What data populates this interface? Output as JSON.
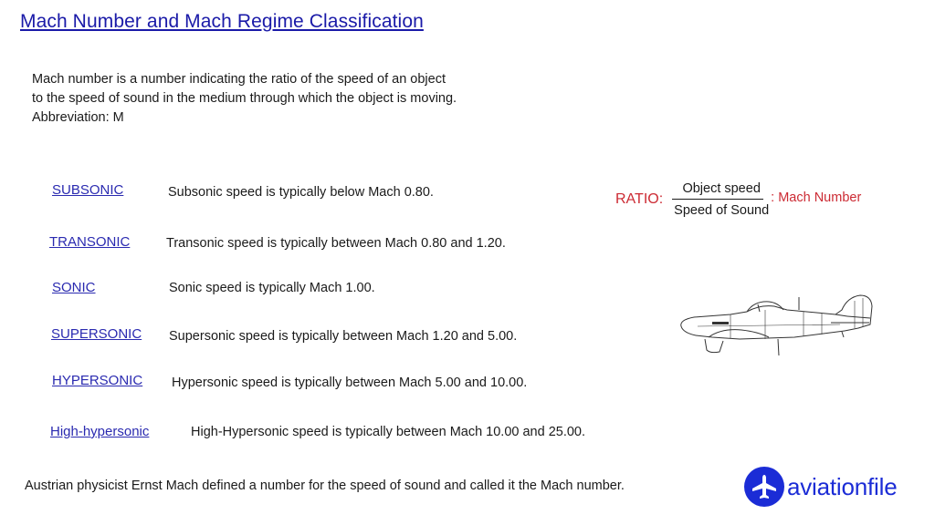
{
  "title": "Mach Number and Mach Regime Classification",
  "intro": {
    "lines": [
      "Mach number is a number indicating the ratio of the speed of an object",
      "to the speed of sound in the medium through which the object is moving.",
      "Abbreviation: M"
    ]
  },
  "regimes": [
    {
      "label": "SUBSONIC",
      "description": "Subsonic speed is typically below Mach 0.80."
    },
    {
      "label": "TRANSONIC",
      "description": "Transonic speed is typically between Mach 0.80 and 1.20."
    },
    {
      "label": "SONIC",
      "description": "Sonic speed is typically Mach 1.00."
    },
    {
      "label": "SUPERSONIC",
      "description": "Supersonic speed is typically between Mach 1.20 and 5.00."
    },
    {
      "label": "HYPERSONIC",
      "description": "Hypersonic speed is typically between Mach 5.00 and 10.00."
    },
    {
      "label": "High-hypersonic",
      "description": "High-Hypersonic speed is typically between Mach 10.00 and 25.00."
    }
  ],
  "ratio": {
    "label": "RATIO:",
    "numerator": "Object speed",
    "denominator": "Speed of Sound",
    "result": ": Mach Number"
  },
  "illustration": {
    "icon": "propeller-fighter-aircraft-illustration"
  },
  "footer": "Austrian physicist Ernst Mach defined a number for the speed of sound and called it the Mach number.",
  "logo": {
    "icon": "airplane-icon",
    "text": "aviationfile"
  },
  "colors": {
    "title": "#1a1aa8",
    "link": "#2a2ab0",
    "ratio_accent": "#cc2a33",
    "logo": "#1b2cd6"
  }
}
